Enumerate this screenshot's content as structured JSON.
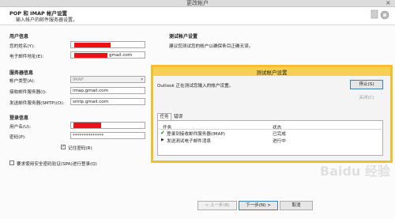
{
  "window": {
    "title": "更改帐户",
    "close_glyph": "×"
  },
  "header": {
    "title": "POP 和 IMAP 帐户设置",
    "subtitle": "输入帐户的邮件服务器设置。"
  },
  "user_info": {
    "heading": "用户信息",
    "name_label": "您的姓名(Y):",
    "email_label": "电子邮件地址(E):",
    "email_value": "gmail.com"
  },
  "server_info": {
    "heading": "服务器信息",
    "account_type_label": "帐户类型(A):",
    "account_type_value": "IMAP",
    "incoming_label": "接收邮件服务器(I):",
    "incoming_value": "imap.gmail.com",
    "outgoing_label": "发送邮件服务器(SMTP)(O):",
    "outgoing_value": "smtp.gmail.com"
  },
  "login_info": {
    "heading": "登录信息",
    "username_label": "用户名(U):",
    "password_label": "密码(P):",
    "password_value": "**************",
    "remember_label": "记住密码(R)",
    "spa_label": "要求使用安全密码验证(SPA)进行登录(Q)"
  },
  "test_settings": {
    "heading": "测试帐户设置",
    "description": "建议您测试您的帐户以确保条目正确无误。"
  },
  "footer": {
    "back": "< 上一步(B)",
    "next": "下一步(N) >",
    "cancel": "取消"
  },
  "dialog": {
    "title": "测试帐户设置",
    "message": "Outlook 正在测试您输入的帐户设置。",
    "stop": "停止(S)",
    "close": "关闭(C)",
    "tabs": [
      "任务",
      "错误"
    ],
    "columns": [
      "任务",
      "状态"
    ],
    "rows": [
      {
        "icon": "check-icon",
        "task": "登录到接收邮件服务器(IMAP)",
        "status": "已完成"
      },
      {
        "icon": "arrow-right-icon",
        "task": "发送测试电子邮件消息",
        "status": "进行中"
      }
    ]
  },
  "watermark": "Baidu 经验",
  "colors": {
    "dialog_border": "#f2c02e",
    "redaction": "#ee1111",
    "check": "#1a8c1a"
  }
}
